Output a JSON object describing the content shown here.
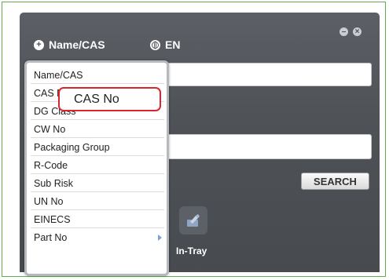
{
  "header": {
    "mode_label": "Name/CAS",
    "language_label": "EN",
    "mode_icon": "plus-circle-icon",
    "language_icon": "globe-icon"
  },
  "window_controls": {
    "minimize_icon": "minimize-icon",
    "close_icon": "close-icon"
  },
  "dropdown": {
    "items": [
      {
        "label": "Name/CAS"
      },
      {
        "label": "CAS No"
      },
      {
        "label": "DG Class"
      },
      {
        "label": "CW No"
      },
      {
        "label": "Packaging Group"
      },
      {
        "label": "R-Code"
      },
      {
        "label": "Sub Risk"
      },
      {
        "label": "UN No"
      },
      {
        "label": "EINECS"
      },
      {
        "label": "Part No",
        "has_submenu": true
      }
    ],
    "highlighted_label": "CAS No"
  },
  "search": {
    "button_label": "SEARCH"
  },
  "tray": {
    "label": "In-Tray",
    "icon": "in-tray-icon"
  },
  "colors": {
    "panel": "#4f5358",
    "frame": "#5fb04a",
    "highlight_border": "#d9262c"
  }
}
